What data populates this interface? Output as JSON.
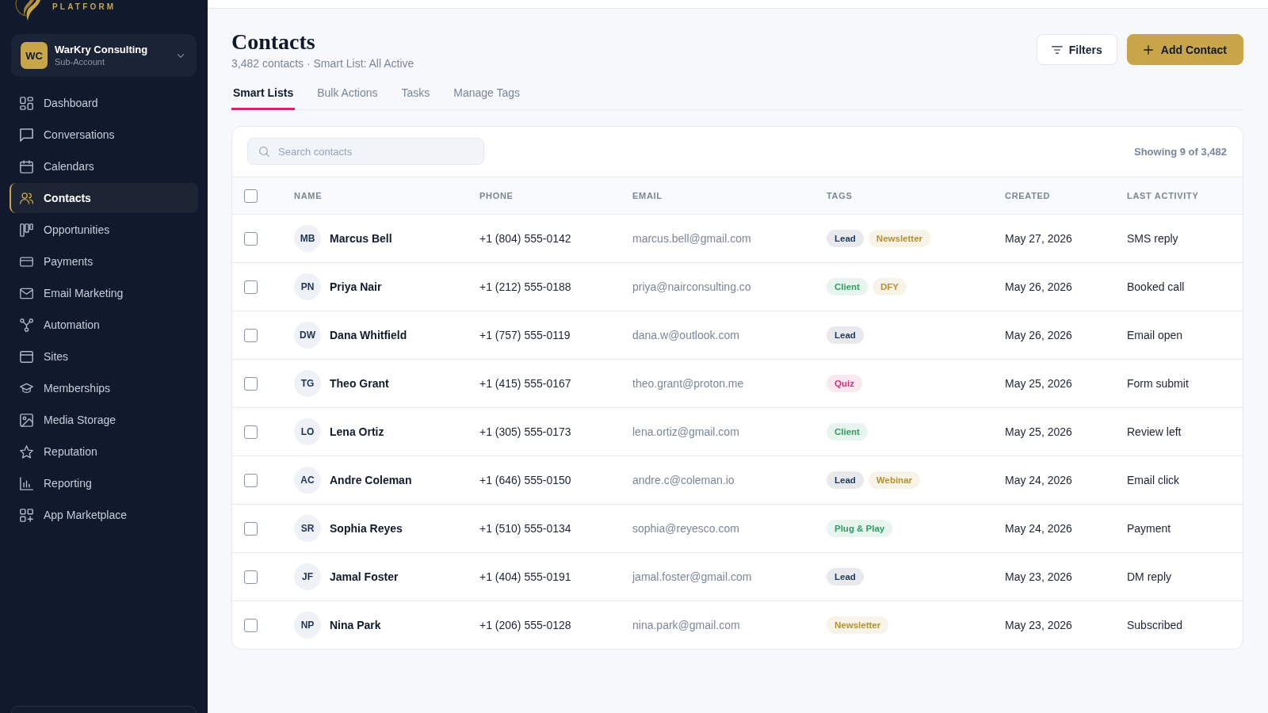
{
  "sidebar": {
    "brand": {
      "tagline": "PLATFORM"
    },
    "account": {
      "initials": "WC",
      "name": "WarKry Consulting",
      "type": "Sub-Account"
    },
    "items": [
      {
        "label": "Dashboard",
        "selected": false
      },
      {
        "label": "Conversations",
        "selected": false
      },
      {
        "label": "Calendars",
        "selected": false
      },
      {
        "label": "Contacts",
        "selected": true
      },
      {
        "label": "Opportunities",
        "selected": false
      },
      {
        "label": "Payments",
        "selected": false
      },
      {
        "label": "Email Marketing",
        "selected": false
      },
      {
        "label": "Automation",
        "selected": false
      },
      {
        "label": "Sites",
        "selected": false
      },
      {
        "label": "Memberships",
        "selected": false
      },
      {
        "label": "Media Storage",
        "selected": false
      },
      {
        "label": "Reputation",
        "selected": false
      },
      {
        "label": "Reporting",
        "selected": false
      },
      {
        "label": "App Marketplace",
        "selected": false
      }
    ]
  },
  "page": {
    "title": "Contacts",
    "subtitle": "3,482 contacts · Smart List: All Active",
    "actions": [
      {
        "label": "Filters",
        "kind": "secondary"
      },
      {
        "label": "Add Contact",
        "kind": "primary"
      }
    ]
  },
  "tabs": [
    {
      "label": "Smart Lists",
      "selected": true
    },
    {
      "label": "Bulk Actions",
      "selected": false
    },
    {
      "label": "Tasks",
      "selected": false
    },
    {
      "label": "Manage Tags",
      "selected": false
    }
  ],
  "table": {
    "search": {
      "placeholder": "Search contacts"
    },
    "count": "Showing 9 of 3,482",
    "select_all": {
      "checked": false
    },
    "columns": [
      "NAME",
      "PHONE",
      "EMAIL",
      "TAGS",
      "CREATED",
      "LAST ACTIVITY"
    ],
    "rows": [
      {
        "selected": false,
        "initials": "MB",
        "name": "Marcus Bell",
        "phone": "+1 (804) 555-0142",
        "email": "marcus.bell@gmail.com",
        "tags": [
          {
            "label": "Lead",
            "color": "#243b5e"
          },
          {
            "label": "Newsletter",
            "color": "#b8902f"
          }
        ],
        "created": "May 27, 2026",
        "last_activity": "SMS reply"
      },
      {
        "selected": false,
        "initials": "PN",
        "name": "Priya Nair",
        "phone": "+1 (212) 555-0188",
        "email": "priya@nairconsulting.co",
        "tags": [
          {
            "label": "Client",
            "color": "#2f9e62"
          },
          {
            "label": "DFY",
            "color": "#b8902f"
          }
        ],
        "created": "May 26, 2026",
        "last_activity": "Booked call"
      },
      {
        "selected": false,
        "initials": "DW",
        "name": "Dana Whitfield",
        "phone": "+1 (757) 555-0119",
        "email": "dana.w@outlook.com",
        "tags": [
          {
            "label": "Lead",
            "color": "#243b5e"
          }
        ],
        "created": "May 26, 2026",
        "last_activity": "Email open"
      },
      {
        "selected": false,
        "initials": "TG",
        "name": "Theo Grant",
        "phone": "+1 (415) 555-0167",
        "email": "theo.grant@proton.me",
        "tags": [
          {
            "label": "Quiz",
            "color": "#d62d75"
          }
        ],
        "created": "May 25, 2026",
        "last_activity": "Form submit"
      },
      {
        "selected": false,
        "initials": "LO",
        "name": "Lena Ortiz",
        "phone": "+1 (305) 555-0173",
        "email": "lena.ortiz@gmail.com",
        "tags": [
          {
            "label": "Client",
            "color": "#2f9e62"
          }
        ],
        "created": "May 25, 2026",
        "last_activity": "Review left"
      },
      {
        "selected": false,
        "initials": "AC",
        "name": "Andre Coleman",
        "phone": "+1 (646) 555-0150",
        "email": "andre.c@coleman.io",
        "tags": [
          {
            "label": "Lead",
            "color": "#243b5e"
          },
          {
            "label": "Webinar",
            "color": "#b8902f"
          }
        ],
        "created": "May 24, 2026",
        "last_activity": "Email click"
      },
      {
        "selected": false,
        "initials": "SR",
        "name": "Sophia Reyes",
        "phone": "+1 (510) 555-0134",
        "email": "sophia@reyesco.com",
        "tags": [
          {
            "label": "Plug & Play",
            "color": "#2f9e62"
          }
        ],
        "created": "May 24, 2026",
        "last_activity": "Payment"
      },
      {
        "selected": false,
        "initials": "JF",
        "name": "Jamal Foster",
        "phone": "+1 (404) 555-0191",
        "email": "jamal.foster@gmail.com",
        "tags": [
          {
            "label": "Lead",
            "color": "#243b5e"
          }
        ],
        "created": "May 23, 2026",
        "last_activity": "DM reply"
      },
      {
        "selected": false,
        "initials": "NP",
        "name": "Nina Park",
        "phone": "+1 (206) 555-0128",
        "email": "nina.park@gmail.com",
        "tags": [
          {
            "label": "Newsletter",
            "color": "#b8902f"
          }
        ],
        "created": "May 23, 2026",
        "last_activity": "Subscribed"
      }
    ]
  }
}
